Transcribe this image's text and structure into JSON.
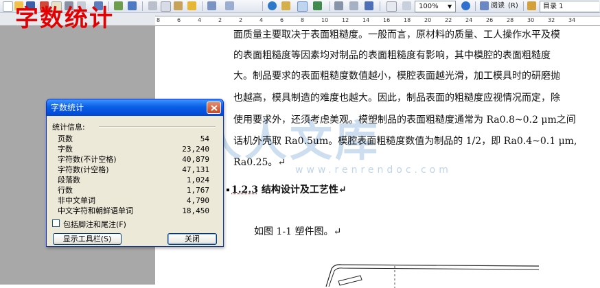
{
  "toolbar": {
    "zoom": "100%",
    "read_label": "阅读",
    "read_accel": "(R)",
    "style_value": "目录 1"
  },
  "overlay_title": "字数统计",
  "ruler": {
    "numbers": [
      "8",
      "6",
      "4",
      "2",
      "2",
      "4",
      "6",
      "8",
      "10",
      "12",
      "14",
      "16",
      "18",
      "20",
      "22",
      "24",
      "26",
      "28",
      "30",
      "32",
      "34"
    ]
  },
  "document": {
    "lines": [
      "面质量主要取决于表面粗糙度。一般而言，原材料的质量、工人操作水平及模",
      "的表面粗糙度等因素均对制品的表面粗糙度有影响，其中模腔的表面粗糙度",
      "大。制品要求的表面粗糙度数值越小，模腔表面越光滑，加工模具时的研磨抛",
      "也越高，模具制造的难度也越大。因此，制品表面的粗糙度应视情况而定，除",
      "使用要求外，还须考虑美观。模塑制品的表面粗糙度通常为 Ra0.8~0.2 μm之间",
      "话机外壳取 Ra0.5um。模腔表面粗糙度数值为制品的  1/2，即 Ra0.4~0.1 μm,",
      "Ra0.25。↵"
    ],
    "heading_number": "1.2.3",
    "heading_text": " 结构设计及工艺性↵",
    "figure_caption": "如图 1-1 塑件图。↵",
    "watermark": "人人文库",
    "watermark_url": "www.renrendoc.com"
  },
  "dialog": {
    "title": "字数统计",
    "group_label": "统计信息:",
    "stats": [
      {
        "label": "页数",
        "value": "54"
      },
      {
        "label": "字数",
        "value": "23,240"
      },
      {
        "label": "字符数(不计空格)",
        "value": "40,879"
      },
      {
        "label": "字符数(计空格)",
        "value": "47,131"
      },
      {
        "label": "段落数",
        "value": "1,024"
      },
      {
        "label": "行数",
        "value": "1,767"
      },
      {
        "label": "非中文单词",
        "value": "4,790"
      },
      {
        "label": "中文字符和朝鲜语单词",
        "value": "18,450"
      }
    ],
    "checkbox_label": "包括脚注和尾注(F)",
    "show_toolbar_button": "显示工具栏(S)",
    "close_button": "关闭"
  },
  "colors": {
    "overlay_title": "#e30000",
    "dialog_title_bar": "#0a5fe6",
    "dialog_body": "#ece9d8",
    "page_margin_gray": "#a8a8a8"
  }
}
